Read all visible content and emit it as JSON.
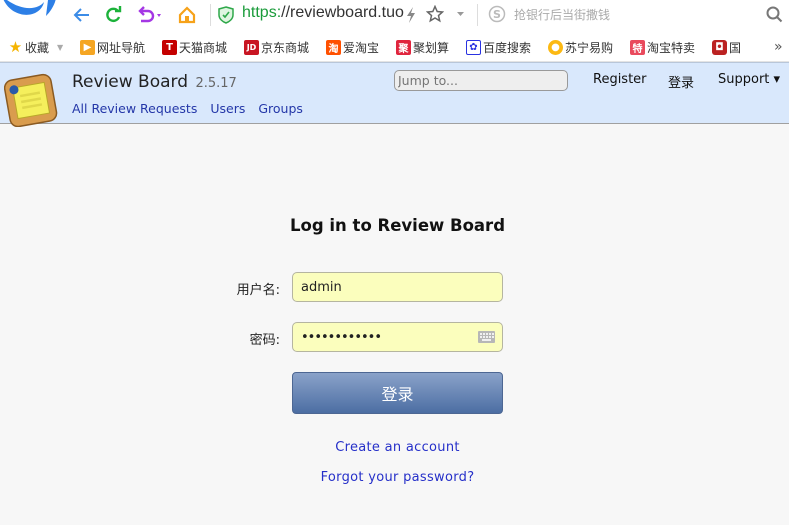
{
  "browser": {
    "url_scheme": "https:",
    "url_rest": "//reviewboard.tuol",
    "search_hint": "抢银行后当街撒钱",
    "bookmarks": [
      {
        "label": "收藏",
        "icon": "star-icon"
      },
      {
        "label": "网址导航",
        "icon": "nav-arrow-icon"
      },
      {
        "label": "天猫商城",
        "icon": "tmall-icon"
      },
      {
        "label": "京东商城",
        "icon": "jd-icon"
      },
      {
        "label": "爱淘宝",
        "icon": "taobao-icon"
      },
      {
        "label": "聚划算",
        "icon": "juhuasuan-icon"
      },
      {
        "label": "百度搜索",
        "icon": "baidu-paw-icon"
      },
      {
        "label": "苏宁易购",
        "icon": "suning-icon"
      },
      {
        "label": "淘宝特卖",
        "icon": "temai-icon"
      },
      {
        "label": "国",
        "icon": "bear-icon"
      }
    ],
    "more_label": "»"
  },
  "header": {
    "title": "Review Board",
    "version": "2.5.17",
    "nav": [
      "All Review Requests",
      "Users",
      "Groups"
    ],
    "jump_placeholder": "Jump to...",
    "register": "Register",
    "login": "登录",
    "support": "Support ▾"
  },
  "login": {
    "title": "Log in to Review Board",
    "username_label": "用户名:",
    "username_value": "admin",
    "password_label": "密码:",
    "password_value": "••••••••••••",
    "submit": "登录",
    "create_account": "Create an account",
    "forgot_password": "Forgot your password?"
  }
}
